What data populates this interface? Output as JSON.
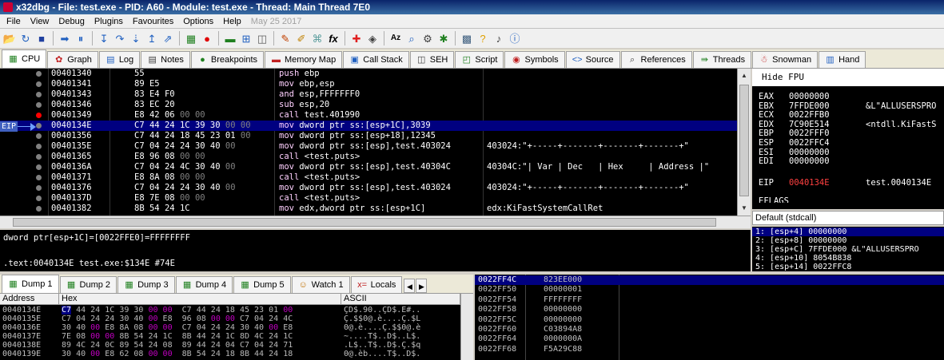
{
  "window": {
    "title": "x32dbg - File: test.exe - PID: A60 - Module: test.exe - Thread: Main Thread 7E0"
  },
  "menu": [
    "File",
    "View",
    "Debug",
    "Plugins",
    "Favourites",
    "Options",
    "Help"
  ],
  "menu_date": "May 25 2017",
  "toolbar": {
    "icons": [
      "open-icon",
      "restart-icon",
      "stop-icon",
      "run-icon",
      "pause-icon",
      "step-into-icon",
      "step-over-icon",
      "trace-icon",
      "execute-till-return-icon",
      "run-to-user-code-icon",
      "script-icon",
      "breakpoint-icon",
      "memory-icon",
      "call-stack-icon",
      "seh-icon",
      "comment-icon",
      "label-icon",
      "bookmark-icon",
      "function-icon",
      "patch-icon",
      "highlight-icon",
      "strings-icon",
      "references-icon",
      "settings-icon",
      "plugins-icon",
      "calculator-icon",
      "help-icon",
      "music-icon",
      "about-icon"
    ],
    "labels": {
      "fx": "fx",
      "az": "Az"
    }
  },
  "tabs": [
    {
      "label": "CPU",
      "icon": "cpu-icon",
      "glyph": "▦",
      "active": true
    },
    {
      "label": "Graph",
      "icon": "graph-icon",
      "glyph": "✿"
    },
    {
      "label": "Log",
      "icon": "log-icon",
      "glyph": "▤"
    },
    {
      "label": "Notes",
      "icon": "notes-icon",
      "glyph": "▤"
    },
    {
      "label": "Breakpoints",
      "icon": "breakpoint-icon",
      "glyph": "●"
    },
    {
      "label": "Memory Map",
      "icon": "memory-map-icon",
      "glyph": "▬"
    },
    {
      "label": "Call Stack",
      "icon": "call-stack-icon",
      "glyph": "▣"
    },
    {
      "label": "SEH",
      "icon": "seh-icon",
      "glyph": "◫"
    },
    {
      "label": "Script",
      "icon": "script-icon",
      "glyph": "◰"
    },
    {
      "label": "Symbols",
      "icon": "symbols-icon",
      "glyph": "◉"
    },
    {
      "label": "Source",
      "icon": "source-icon",
      "glyph": "<>"
    },
    {
      "label": "References",
      "icon": "references-icon",
      "glyph": "⌕"
    },
    {
      "label": "Threads",
      "icon": "threads-icon",
      "glyph": "⇛"
    },
    {
      "label": "Snowman",
      "icon": "snowman-icon",
      "glyph": "☃"
    },
    {
      "label": "Hand",
      "icon": "handles-icon",
      "glyph": "▥"
    }
  ],
  "disasm": {
    "eip_label": "EIP",
    "rows": [
      {
        "addr": "00401340",
        "bytes": [
          [
            "55",
            "b"
          ]
        ],
        "mn": "push",
        "ops": "ebp",
        "cmt": "",
        "bp": "gray"
      },
      {
        "addr": "00401341",
        "bytes": [
          [
            "89",
            "b"
          ],
          [
            "E5",
            "b"
          ]
        ],
        "mn": "mov",
        "ops": "ebp,esp",
        "cmt": "",
        "bp": "gray"
      },
      {
        "addr": "00401343",
        "bytes": [
          [
            "83",
            "b"
          ],
          [
            "E4",
            "b"
          ],
          [
            "F0",
            "b"
          ]
        ],
        "mn": "and",
        "ops": "esp,FFFFFFF0",
        "cmt": "",
        "bp": "gray"
      },
      {
        "addr": "00401346",
        "bytes": [
          [
            "83",
            "b"
          ],
          [
            "EC",
            "b"
          ],
          [
            "20",
            "b"
          ]
        ],
        "mn": "sub",
        "ops": "esp,20",
        "cmt": "",
        "bp": "gray"
      },
      {
        "addr": "00401349",
        "bytes": [
          [
            "E8",
            "b"
          ],
          [
            "42",
            "b"
          ],
          [
            "06",
            "b"
          ],
          [
            "00",
            "z"
          ],
          [
            "00",
            "z"
          ]
        ],
        "mn": "call",
        "ops": "test.401990",
        "cmt": "",
        "bp": "red"
      },
      {
        "addr": "0040134E",
        "bytes": [
          [
            "C7",
            "b"
          ],
          [
            "44",
            "b"
          ],
          [
            "24",
            "b"
          ],
          [
            "1C",
            "b"
          ],
          [
            "39",
            "b"
          ],
          [
            "30",
            "b"
          ],
          [
            "00",
            "z"
          ],
          [
            "00",
            "z"
          ]
        ],
        "mn": "mov",
        "ops": "dword ptr ss:[esp+1C],3039",
        "cmt": "",
        "bp": "gray",
        "sel": true
      },
      {
        "addr": "00401356",
        "bytes": [
          [
            "C7",
            "b"
          ],
          [
            "44",
            "b"
          ],
          [
            "24",
            "b"
          ],
          [
            "18",
            "b"
          ],
          [
            "45",
            "b"
          ],
          [
            "23",
            "b"
          ],
          [
            "01",
            "b"
          ],
          [
            "00",
            "z"
          ]
        ],
        "mn": "mov",
        "ops": "dword ptr ss:[esp+18],12345",
        "cmt": "",
        "bp": "gray"
      },
      {
        "addr": "0040135E",
        "bytes": [
          [
            "C7",
            "b"
          ],
          [
            "04",
            "b"
          ],
          [
            "24",
            "b"
          ],
          [
            "24",
            "b"
          ],
          [
            "30",
            "b"
          ],
          [
            "40",
            "b"
          ],
          [
            "00",
            "z"
          ]
        ],
        "mn": "mov",
        "ops": "dword ptr ss:[esp],test.403024",
        "cmt": "403024:\"+-----+-------+-------+-------+\"",
        "bp": "gray"
      },
      {
        "addr": "00401365",
        "bytes": [
          [
            "E8",
            "b"
          ],
          [
            "96",
            "b"
          ],
          [
            "08",
            "b"
          ],
          [
            "00",
            "z"
          ],
          [
            "00",
            "z"
          ]
        ],
        "mn": "call",
        "ops": "<test.puts>",
        "cmt": "",
        "bp": "gray"
      },
      {
        "addr": "0040136A",
        "bytes": [
          [
            "C7",
            "b"
          ],
          [
            "04",
            "b"
          ],
          [
            "24",
            "b"
          ],
          [
            "4C",
            "b"
          ],
          [
            "30",
            "b"
          ],
          [
            "40",
            "b"
          ],
          [
            "00",
            "z"
          ]
        ],
        "mn": "mov",
        "ops": "dword ptr ss:[esp],test.40304C",
        "cmt": "40304C:\"| Var | Dec   | Hex     | Address |\"",
        "bp": "gray"
      },
      {
        "addr": "00401371",
        "bytes": [
          [
            "E8",
            "b"
          ],
          [
            "8A",
            "b"
          ],
          [
            "08",
            "b"
          ],
          [
            "00",
            "z"
          ],
          [
            "00",
            "z"
          ]
        ],
        "mn": "call",
        "ops": "<test.puts>",
        "cmt": "",
        "bp": "gray"
      },
      {
        "addr": "00401376",
        "bytes": [
          [
            "C7",
            "b"
          ],
          [
            "04",
            "b"
          ],
          [
            "24",
            "b"
          ],
          [
            "24",
            "b"
          ],
          [
            "30",
            "b"
          ],
          [
            "40",
            "b"
          ],
          [
            "00",
            "z"
          ]
        ],
        "mn": "mov",
        "ops": "dword ptr ss:[esp],test.403024",
        "cmt": "403024:\"+-----+-------+-------+-------+\"",
        "bp": "gray"
      },
      {
        "addr": "0040137D",
        "bytes": [
          [
            "E8",
            "b"
          ],
          [
            "7E",
            "b"
          ],
          [
            "08",
            "b"
          ],
          [
            "00",
            "z"
          ],
          [
            "00",
            "z"
          ]
        ],
        "mn": "call",
        "ops": "<test.puts>",
        "cmt": "",
        "bp": "gray"
      },
      {
        "addr": "00401382",
        "bytes": [
          [
            "8B",
            "b"
          ],
          [
            "54",
            "b"
          ],
          [
            "24",
            "b"
          ],
          [
            "1C",
            "b"
          ]
        ],
        "mn": "mov",
        "ops": "edx,dword ptr ss:[esp+1C]",
        "cmt": "edx:KiFastSystemCallRet",
        "bp": "gray"
      }
    ]
  },
  "info": {
    "line1": "dword ptr[esp+1C]=[0022FFE0]=FFFFFFFF",
    "line2": ".text:0040134E test.exe:$134E #74E"
  },
  "registers": {
    "hide_fpu": "Hide FPU",
    "rows": [
      {
        "name": "EAX",
        "value": "00000000",
        "comment": ""
      },
      {
        "name": "EBX",
        "value": "7FFDE000",
        "comment": "&L\"ALLUSERSPRO"
      },
      {
        "name": "ECX",
        "value": "0022FFB0",
        "comment": ""
      },
      {
        "name": "EDX",
        "value": "7C90E514",
        "comment": "<ntdll.KiFastS"
      },
      {
        "name": "EBP",
        "value": "0022FFF0",
        "comment": ""
      },
      {
        "name": "ESP",
        "value": "0022FFC4",
        "comment": ""
      },
      {
        "name": "ESI",
        "value": "00000000",
        "comment": ""
      },
      {
        "name": "EDI",
        "value": "00000000",
        "comment": ""
      }
    ],
    "eip": {
      "name": "EIP",
      "value": "0040134E",
      "comment": "test.0040134E"
    },
    "partial": "EFLAGS"
  },
  "callconv": "Default (stdcall)",
  "stackargs": [
    "1: [esp+4] 00000000",
    "2: [esp+8] 00000000",
    "3: [esp+C] 7FFDE000 &L\"ALLUSERSPRO",
    "4: [esp+10] 8054B838",
    "5: [esp+14] 0022FFC8"
  ],
  "dumptabs": [
    {
      "label": "Dump 1",
      "icon": "dump-icon",
      "glyph": "▦",
      "active": true
    },
    {
      "label": "Dump 2",
      "icon": "dump-icon",
      "glyph": "▦"
    },
    {
      "label": "Dump 3",
      "icon": "dump-icon",
      "glyph": "▦"
    },
    {
      "label": "Dump 4",
      "icon": "dump-icon",
      "glyph": "▦"
    },
    {
      "label": "Dump 5",
      "icon": "dump-icon",
      "glyph": "▦"
    },
    {
      "label": "Watch 1",
      "icon": "watch-icon",
      "glyph": "☺"
    },
    {
      "label": "Locals",
      "icon": "locals-icon",
      "glyph": "x="
    }
  ],
  "dump": {
    "headers": [
      "Address",
      "Hex",
      "ASCII"
    ],
    "rows": [
      {
        "addr": "0040134E",
        "hex": [
          "C7",
          "44",
          "24",
          "1C",
          "39",
          "30",
          "00",
          "00",
          "C7",
          "44",
          "24",
          "18",
          "45",
          "23",
          "01",
          "00"
        ],
        "ascii": "ÇD$.90..ÇD$.E#..",
        "selfirst": true
      },
      {
        "addr": "0040135E",
        "hex": [
          "C7",
          "04",
          "24",
          "24",
          "30",
          "40",
          "00",
          "E8",
          "96",
          "08",
          "00",
          "00",
          "C7",
          "04",
          "24",
          "4C"
        ],
        "ascii": "Ç.$$0@.è....Ç.$L"
      },
      {
        "addr": "0040136E",
        "hex": [
          "30",
          "40",
          "00",
          "E8",
          "8A",
          "08",
          "00",
          "00",
          "C7",
          "04",
          "24",
          "24",
          "30",
          "40",
          "00",
          "E8"
        ],
        "ascii": "0@.è....Ç.$$0@.è"
      },
      {
        "addr": "0040137E",
        "hex": [
          "7E",
          "08",
          "00",
          "00",
          "8B",
          "54",
          "24",
          "1C",
          "8B",
          "44",
          "24",
          "1C",
          "8D",
          "4C",
          "24",
          "1C"
        ],
        "ascii": "~....T$..D$..L$."
      },
      {
        "addr": "0040138E",
        "hex": [
          "89",
          "4C",
          "24",
          "0C",
          "89",
          "54",
          "24",
          "08",
          "89",
          "44",
          "24",
          "04",
          "C7",
          "04",
          "24",
          "71"
        ],
        "ascii": ".L$..T$..D$.Ç.$q"
      },
      {
        "addr": "0040139E",
        "hex": [
          "30",
          "40",
          "00",
          "E8",
          "62",
          "08",
          "00",
          "00",
          "8B",
          "54",
          "24",
          "18",
          "8B",
          "44",
          "24",
          "18"
        ],
        "ascii": "0@.èb....T$..D$."
      }
    ]
  },
  "stack": {
    "rows": [
      {
        "addr": "0022FF4C",
        "value": "823EE000",
        "sel": true
      },
      {
        "addr": "0022FF50",
        "value": "00000001"
      },
      {
        "addr": "0022FF54",
        "value": "FFFFFFFF"
      },
      {
        "addr": "0022FF58",
        "value": "00000000"
      },
      {
        "addr": "0022FF5C",
        "value": "00000000"
      },
      {
        "addr": "0022FF60",
        "value": "C03894A8"
      },
      {
        "addr": "0022FF64",
        "value": "0000000A"
      },
      {
        "addr": "0022FF68",
        "value": "F5A29C88"
      }
    ]
  },
  "colors": {
    "selection": "#000080",
    "breakpoint": "#ff0000",
    "eip_arrow": "#6ea0ff",
    "title_bar": "#0a246a"
  }
}
